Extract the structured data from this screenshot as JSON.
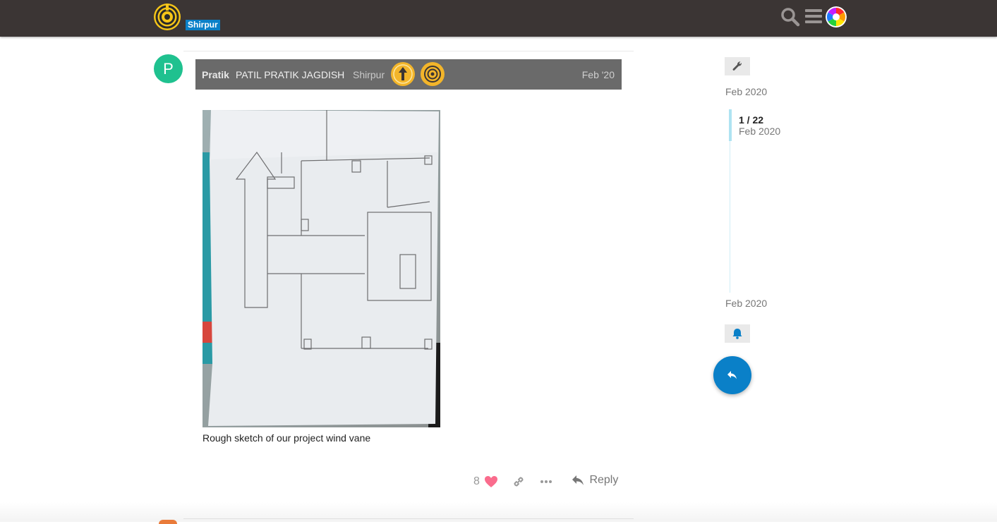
{
  "header": {
    "site_label": "Shirpur",
    "icons": [
      "logo-icon",
      "search-icon",
      "menu-icon",
      "avatar-color-wheel"
    ]
  },
  "post": {
    "avatar_letter": "P",
    "username": "Pratik",
    "full_name": "PATIL PRATIK JAGDISH",
    "user_title": "Shirpur",
    "date": "Feb '20",
    "caption": "Rough sketch of our project wind vane",
    "likes": "8",
    "reply_label": "Reply"
  },
  "timeline": {
    "start_date": "Feb 2020",
    "position": "1 / 22",
    "position_date": "Feb 2020",
    "end_date": "Feb 2020"
  },
  "colors": {
    "header_bg": "#3b3534",
    "accent": "#0a80c8",
    "avatar": "#1fc18f",
    "heart": "#fa6c8d"
  }
}
